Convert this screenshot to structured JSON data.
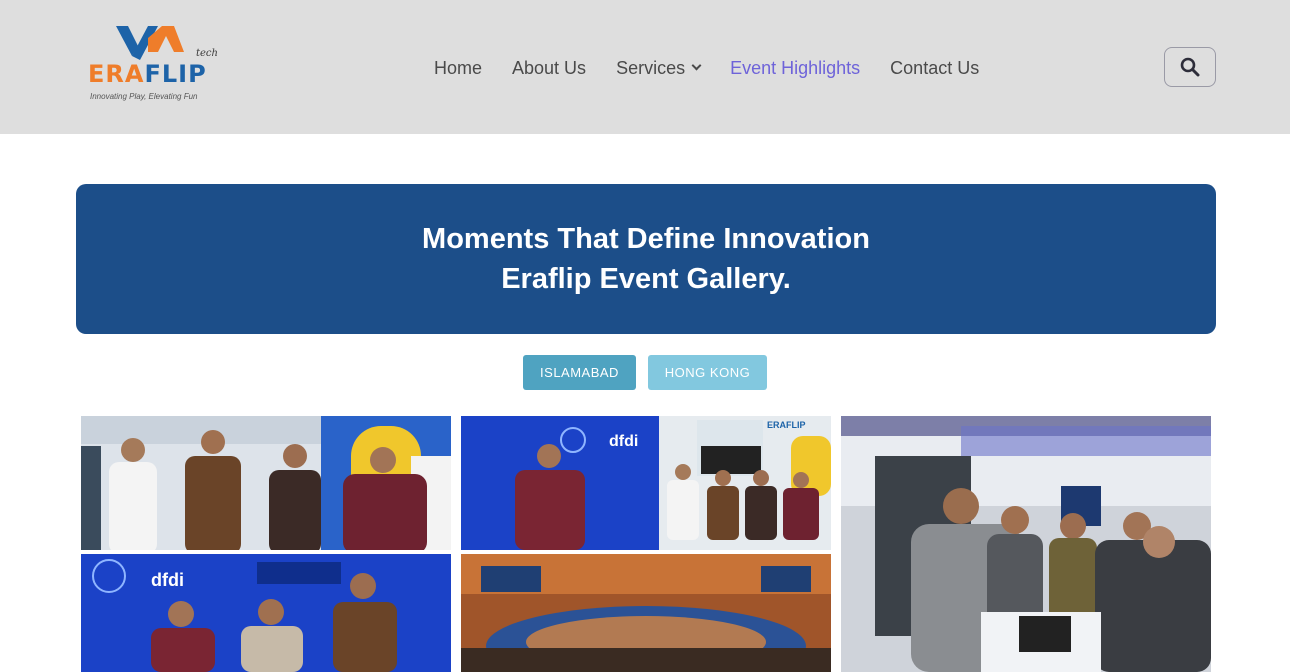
{
  "logo": {
    "tech": "tech",
    "word_era": "ERA",
    "word_flip": "FLIP",
    "tagline": "Innovating Play, Elevating Fun"
  },
  "nav": {
    "home": "Home",
    "about": "About Us",
    "services": "Services",
    "events": "Event Highlights",
    "contact": "Contact Us"
  },
  "icons": {
    "search": "search-icon",
    "services_dropdown": "chevron-down-icon"
  },
  "banner": {
    "line1": "Moments That Define Innovation",
    "line2": "Eraflip Event Gallery."
  },
  "filters": {
    "islamabad": "ISLAMABAD",
    "hong_kong": "HONG KONG"
  },
  "gallery": {
    "photo1_text": "dfdi",
    "photo2_text": "dfdi",
    "photo2_booth": "ERAFLIP"
  },
  "colors": {
    "header_bg": "#dedede",
    "banner_bg": "#1c4e89",
    "active_nav": "#6e63d9",
    "filter_primary": "#4fa3c1",
    "filter_secondary": "#82c8df",
    "brand_orange": "#ef7d2a",
    "brand_blue": "#1d63a8"
  }
}
